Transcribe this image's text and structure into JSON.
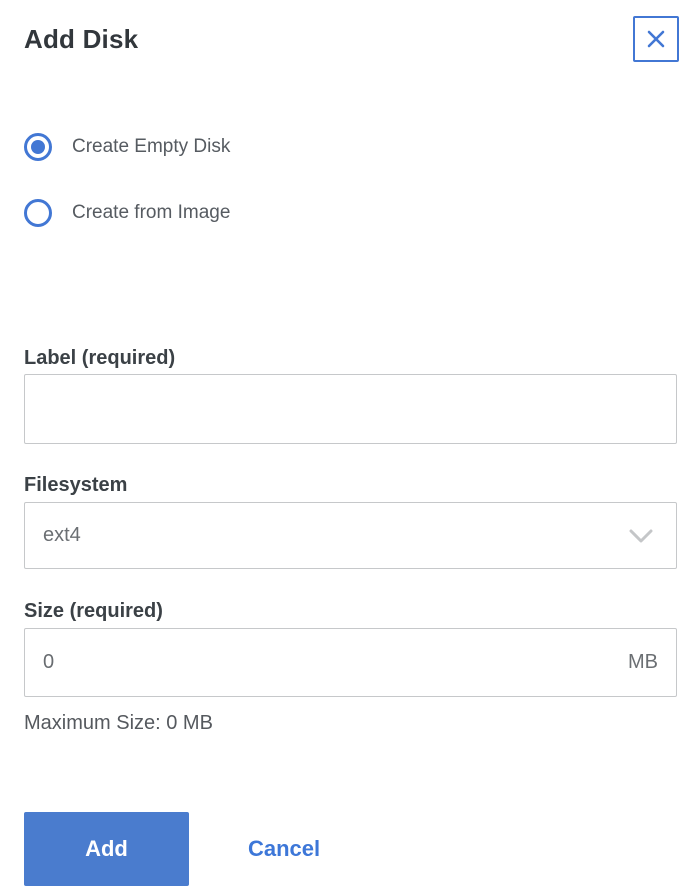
{
  "dialog": {
    "title": "Add Disk"
  },
  "icons": {
    "close": "x-mark",
    "dropdown": "chevron-down"
  },
  "radio_options": [
    {
      "label": "Create Empty Disk",
      "selected": true
    },
    {
      "label": "Create from Image",
      "selected": false
    }
  ],
  "fields": {
    "label": {
      "label": "Label (required)",
      "value": "",
      "placeholder": ""
    },
    "filesystem": {
      "label": "Filesystem",
      "value": "ext4"
    },
    "size": {
      "label": "Size (required)",
      "value": "0",
      "unit": "MB",
      "hint": "Maximum Size: 0 MB"
    }
  },
  "actions": {
    "add": "Add",
    "cancel": "Cancel"
  },
  "colors": {
    "accent_blue": "#4277d4",
    "button_blue": "#4a7cce",
    "border_gray": "#c6c8ca"
  }
}
